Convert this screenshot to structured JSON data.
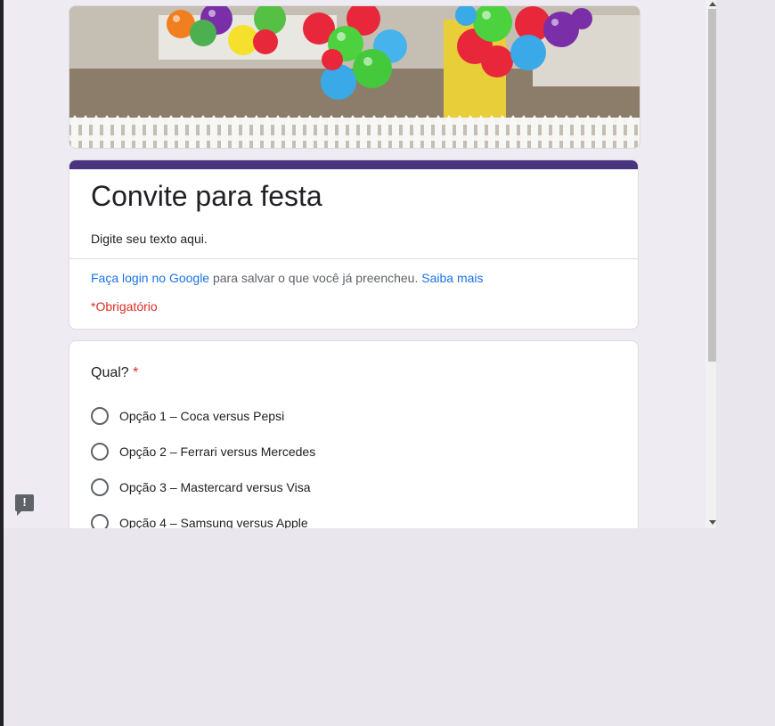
{
  "form": {
    "title": "Convite para festa",
    "description": "Digite seu texto aqui.",
    "login_link": "Faça login no Google",
    "login_text": " para salvar o que você já preencheu. ",
    "learn_more": "Saiba mais",
    "required_note": "*Obrigatório",
    "accent_color": "#4a347f"
  },
  "question": {
    "title": "Qual? ",
    "required_mark": "*",
    "options": [
      {
        "label": "Opção 1 – Coca versus Pepsi"
      },
      {
        "label": "Opção 2 – Ferrari versus Mercedes"
      },
      {
        "label": "Opção 3 – Mastercard versus Visa"
      },
      {
        "label": "Opção 4 – Samsung versus Apple"
      }
    ]
  },
  "feedback": {
    "icon": "report-problem-icon",
    "glyph": "!"
  },
  "banner": {
    "image": "party-balloons-porch"
  }
}
